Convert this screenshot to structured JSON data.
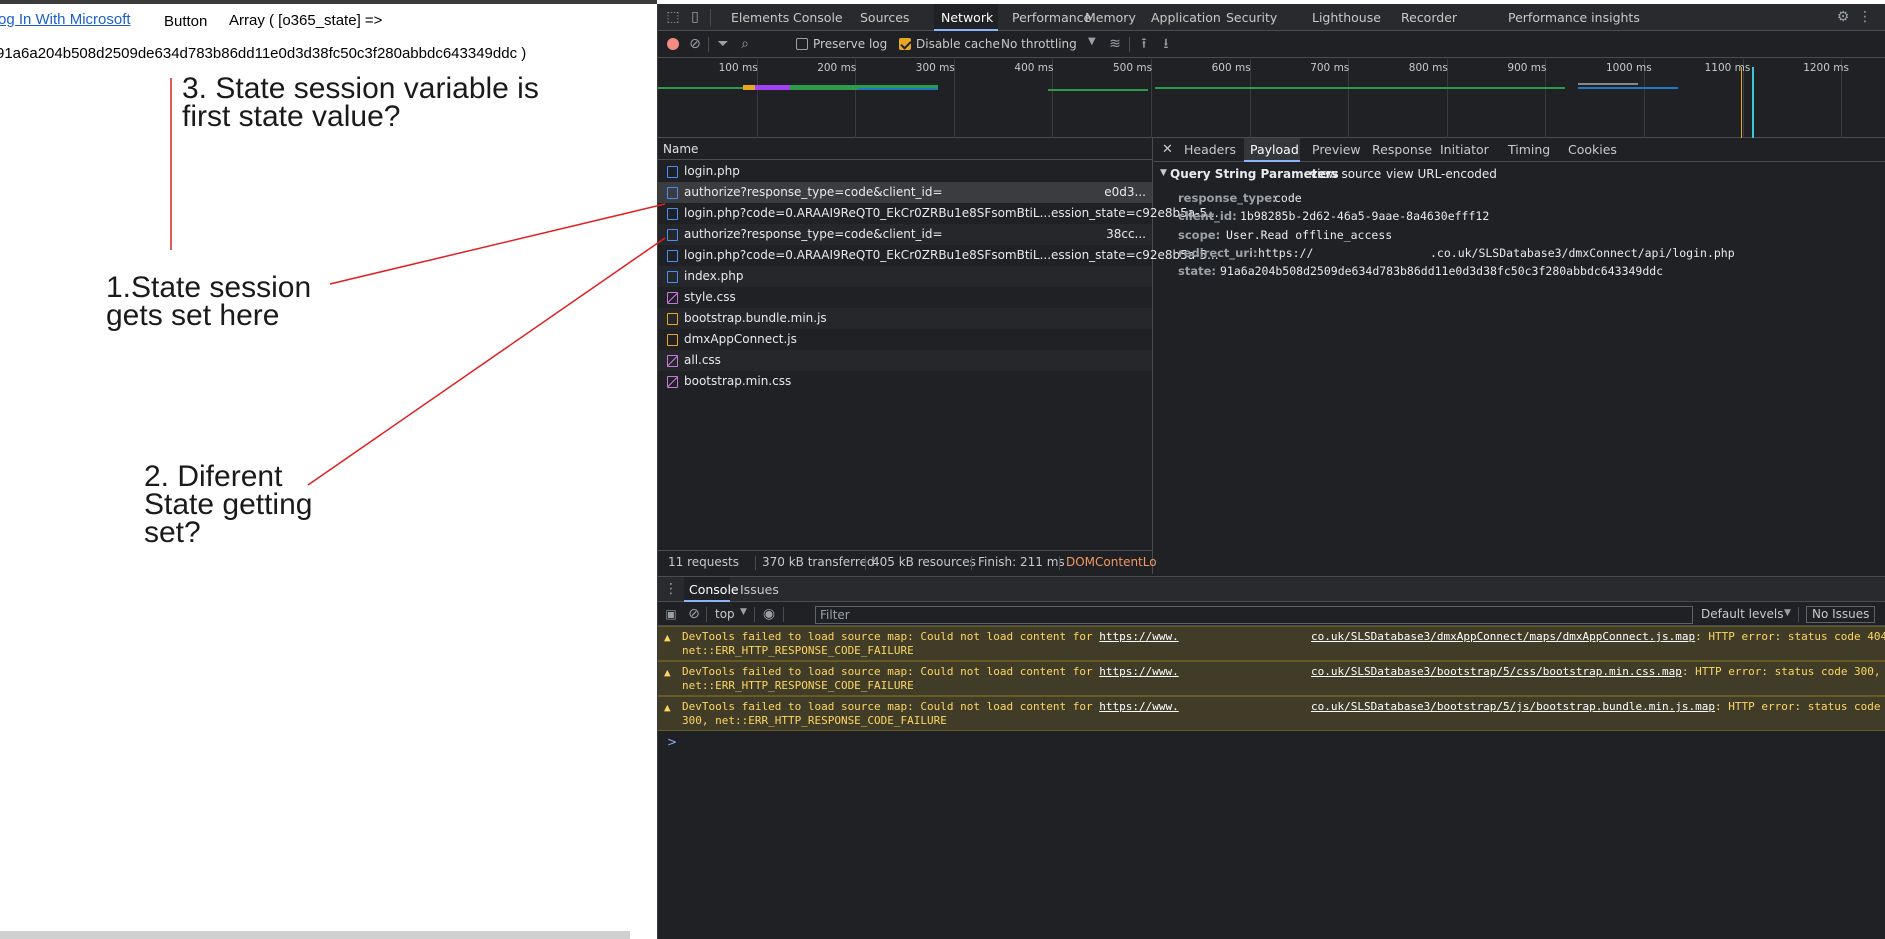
{
  "page": {
    "ms_login_link": "og In With Microsoft",
    "button_label": "Button",
    "array_line1": "Array ( [o365_state] =>",
    "array_line2": "91a6a204b508d2509de634d783b86dd11e0d3d38fc50c3f280abbdc643349ddc )"
  },
  "annotations": {
    "a3": [
      "3. State session variable is",
      "first state value?"
    ],
    "a1": [
      "1.State session",
      "gets set here"
    ],
    "a2": [
      "2. Diferent",
      "State getting",
      "set?"
    ]
  },
  "devtools": {
    "tabs": [
      "Elements",
      "Console",
      "Sources",
      "Network",
      "Performance",
      "Memory",
      "Application",
      "Security",
      "Lighthouse",
      "Recorder",
      "Performance insights"
    ],
    "active_tab": "Network",
    "toolbar": {
      "preserve_log": "Preserve log",
      "disable_cache": "Disable cache",
      "throttling": "No throttling"
    },
    "timeline_ticks": [
      "100 ms",
      "200 ms",
      "300 ms",
      "400 ms",
      "500 ms",
      "600 ms",
      "700 ms",
      "800 ms",
      "900 ms",
      "1000 ms",
      "1100 ms",
      "1200 ms"
    ],
    "name_header": "Name",
    "requests": [
      {
        "name": "login.php",
        "type": "doc",
        "tail": ""
      },
      {
        "name": "authorize?response_type=code&client_id=",
        "type": "doc",
        "tail": "e0d3..."
      },
      {
        "name": "login.php?code=0.ARAAI9ReQT0_EkCr0ZRBu1e8SFsomBtiL...ession_state=c92e8b5a-5...",
        "type": "doc",
        "tail": ""
      },
      {
        "name": "authorize?response_type=code&client_id=",
        "type": "doc",
        "tail": "38cc..."
      },
      {
        "name": "login.php?code=0.ARAAI9ReQT0_EkCr0ZRBu1e8SFsomBtiL...ession_state=c92e8b5a-5...",
        "type": "doc",
        "tail": ""
      },
      {
        "name": "index.php",
        "type": "doc",
        "tail": ""
      },
      {
        "name": "style.css",
        "type": "css",
        "tail": ""
      },
      {
        "name": "bootstrap.bundle.min.js",
        "type": "js",
        "tail": ""
      },
      {
        "name": "dmxAppConnect.js",
        "type": "js",
        "tail": ""
      },
      {
        "name": "all.css",
        "type": "css",
        "tail": ""
      },
      {
        "name": "bootstrap.min.css",
        "type": "css",
        "tail": ""
      }
    ],
    "status": {
      "requests": "11 requests",
      "transferred": "370 kB transferred",
      "resources": "405 kB resources",
      "finish": "Finish: 211 ms",
      "dcl": "DOMContentLo"
    },
    "detail_tabs": [
      "Headers",
      "Payload",
      "Preview",
      "Response",
      "Initiator",
      "Timing",
      "Cookies"
    ],
    "active_detail_tab": "Payload",
    "payload": {
      "section_title": "Query String Parameters",
      "view_source": "view source",
      "view_url_encoded": "view URL-encoded",
      "params": [
        {
          "key": "response_type:",
          "value": "code"
        },
        {
          "key": "client_id:",
          "value": "1b98285b-2d62-46a5-9aae-8a4630efff12"
        },
        {
          "key": "scope:",
          "value": "User.Read offline_access"
        },
        {
          "key": "redirect_uri:",
          "value": "https://",
          "value_tail": ".co.uk/SLSDatabase3/dmxConnect/api/login.php"
        },
        {
          "key": "state:",
          "value": "91a6a204b508d2509de634d783b86dd11e0d3d38fc50c3f280abbdc643349ddc"
        }
      ]
    },
    "drawer_tabs": [
      "Console",
      "Issues"
    ],
    "console_toolbar": {
      "context": "top",
      "filter_placeholder": "Filter",
      "levels": "Default levels",
      "issues": "No Issues"
    },
    "warnings": [
      {
        "pre": "DevTools failed to load source map: Could not load content for ",
        "link": "https://www.",
        "link2": "co.uk/SLSDatabase3/dmxAppConnect/maps/dmxAppConnect.js.map",
        "post": ": HTTP error: status code 404,",
        "line2": "net::ERR_HTTP_RESPONSE_CODE_FAILURE"
      },
      {
        "pre": "DevTools failed to load source map: Could not load content for ",
        "link": "https://www.",
        "link2": "co.uk/SLSDatabase3/bootstrap/5/css/bootstrap.min.css.map",
        "post": ": HTTP error: status code 300,",
        "line2": "net::ERR_HTTP_RESPONSE_CODE_FAILURE"
      },
      {
        "pre": "DevTools failed to load source map: Could not load content for ",
        "link": "https://www.",
        "link2": "co.uk/SLSDatabase3/bootstrap/5/js/bootstrap.bundle.min.js.map",
        "post": ": HTTP error: status code",
        "line2": "300, net::ERR_HTTP_RESPONSE_CODE_FAILURE"
      }
    ],
    "prompt": ">",
    "colors": {
      "accent": "#8ab4f8",
      "warn_bg": "#413c27",
      "warn_text": "#fdd663",
      "annotation_line": "#e02020"
    }
  }
}
